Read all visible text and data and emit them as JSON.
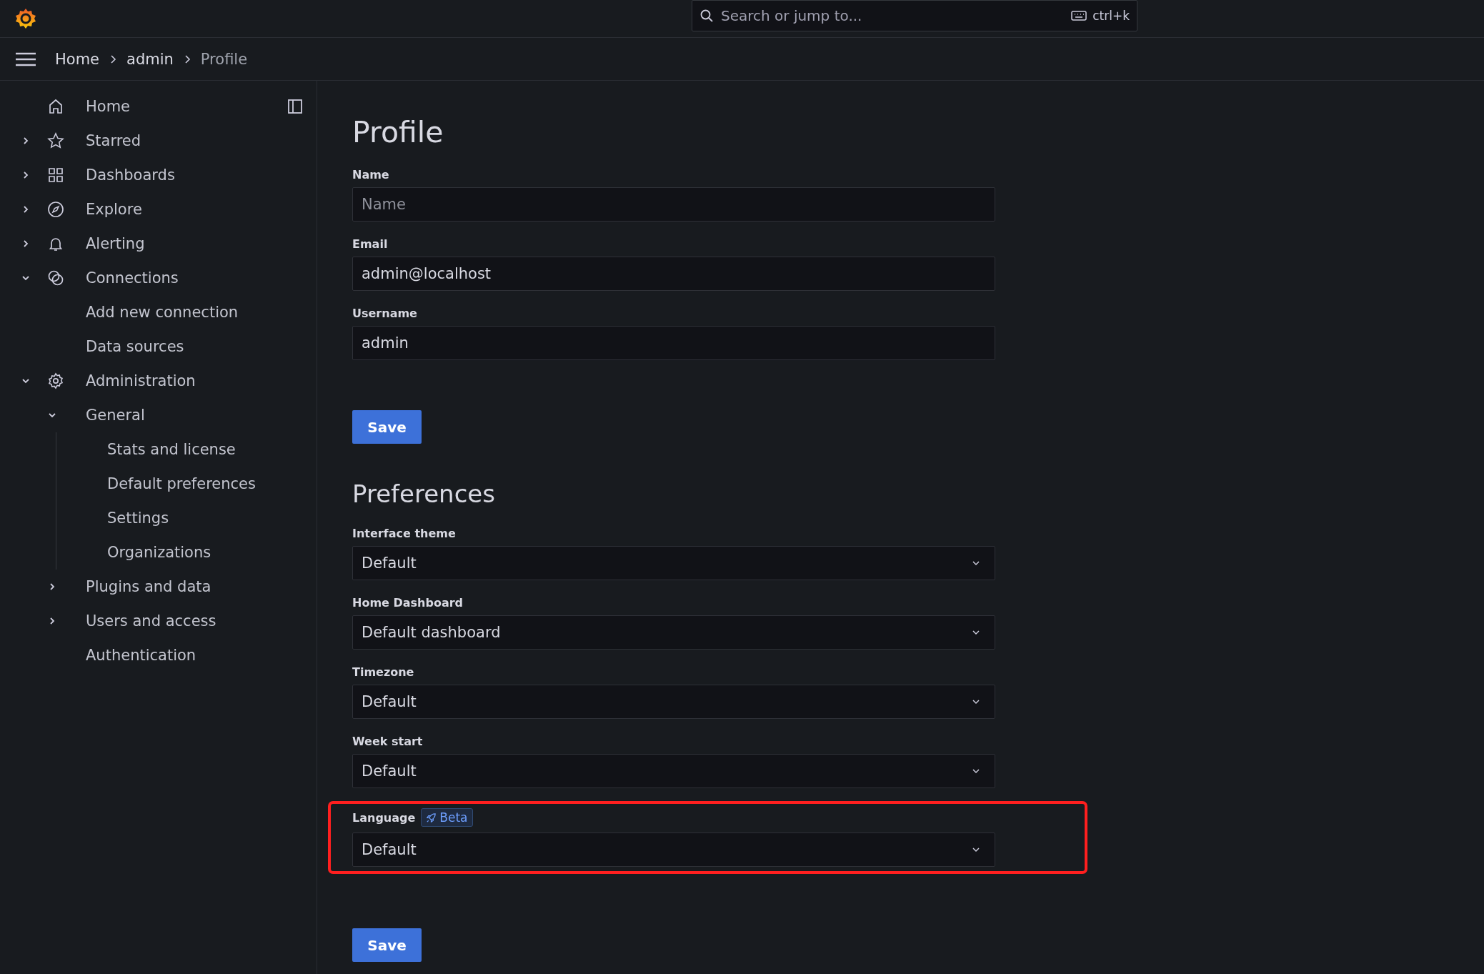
{
  "top_bar": {
    "search": {
      "placeholder": "Search or jump to...",
      "shortcut": "ctrl+k"
    }
  },
  "breadcrumbs": [
    {
      "label": "Home",
      "selected": false
    },
    {
      "label": "admin",
      "selected": false
    },
    {
      "label": "Profile",
      "selected": true
    }
  ],
  "sidebar": {
    "items": [
      {
        "label": "Home",
        "kind": "link"
      },
      {
        "label": "Starred",
        "kind": "group",
        "expanded": false
      },
      {
        "label": "Dashboards",
        "kind": "group",
        "expanded": false
      },
      {
        "label": "Explore",
        "kind": "group",
        "expanded": false
      },
      {
        "label": "Alerting",
        "kind": "group",
        "expanded": false
      },
      {
        "label": "Connections",
        "kind": "group",
        "expanded": true,
        "children": [
          {
            "label": "Add new connection",
            "kind": "link"
          },
          {
            "label": "Data sources",
            "kind": "link"
          }
        ]
      },
      {
        "label": "Administration",
        "kind": "group",
        "expanded": true,
        "children": [
          {
            "label": "General",
            "kind": "group",
            "expanded": true,
            "children": [
              {
                "label": "Stats and license",
                "kind": "link"
              },
              {
                "label": "Default preferences",
                "kind": "link"
              },
              {
                "label": "Settings",
                "kind": "link"
              },
              {
                "label": "Organizations",
                "kind": "link"
              }
            ]
          },
          {
            "label": "Plugins and data",
            "kind": "group",
            "expanded": false
          },
          {
            "label": "Users and access",
            "kind": "group",
            "expanded": false
          },
          {
            "label": "Authentication",
            "kind": "link"
          }
        ]
      }
    ]
  },
  "sections": [
    {
      "title": "Profile",
      "fields": [
        {
          "label": "Name",
          "kind": "text",
          "placeholder": "Name"
        },
        {
          "label": "Email",
          "kind": "text",
          "value": "admin@localhost"
        },
        {
          "label": "Username",
          "kind": "text",
          "value": "admin"
        }
      ],
      "button": "Save"
    },
    {
      "title": "Preferences",
      "fields": [
        {
          "label": "Interface theme",
          "kind": "select",
          "value": "Default"
        },
        {
          "label": "Home Dashboard",
          "kind": "select",
          "value": "Default dashboard"
        },
        {
          "label": "Timezone",
          "kind": "select",
          "value": "Default"
        },
        {
          "label": "Week start",
          "kind": "select",
          "value": "Default"
        },
        {
          "label": "Language",
          "kind": "select",
          "value": "Default",
          "badge": "Beta",
          "highlighted": true
        }
      ],
      "button": "Save"
    }
  ]
}
